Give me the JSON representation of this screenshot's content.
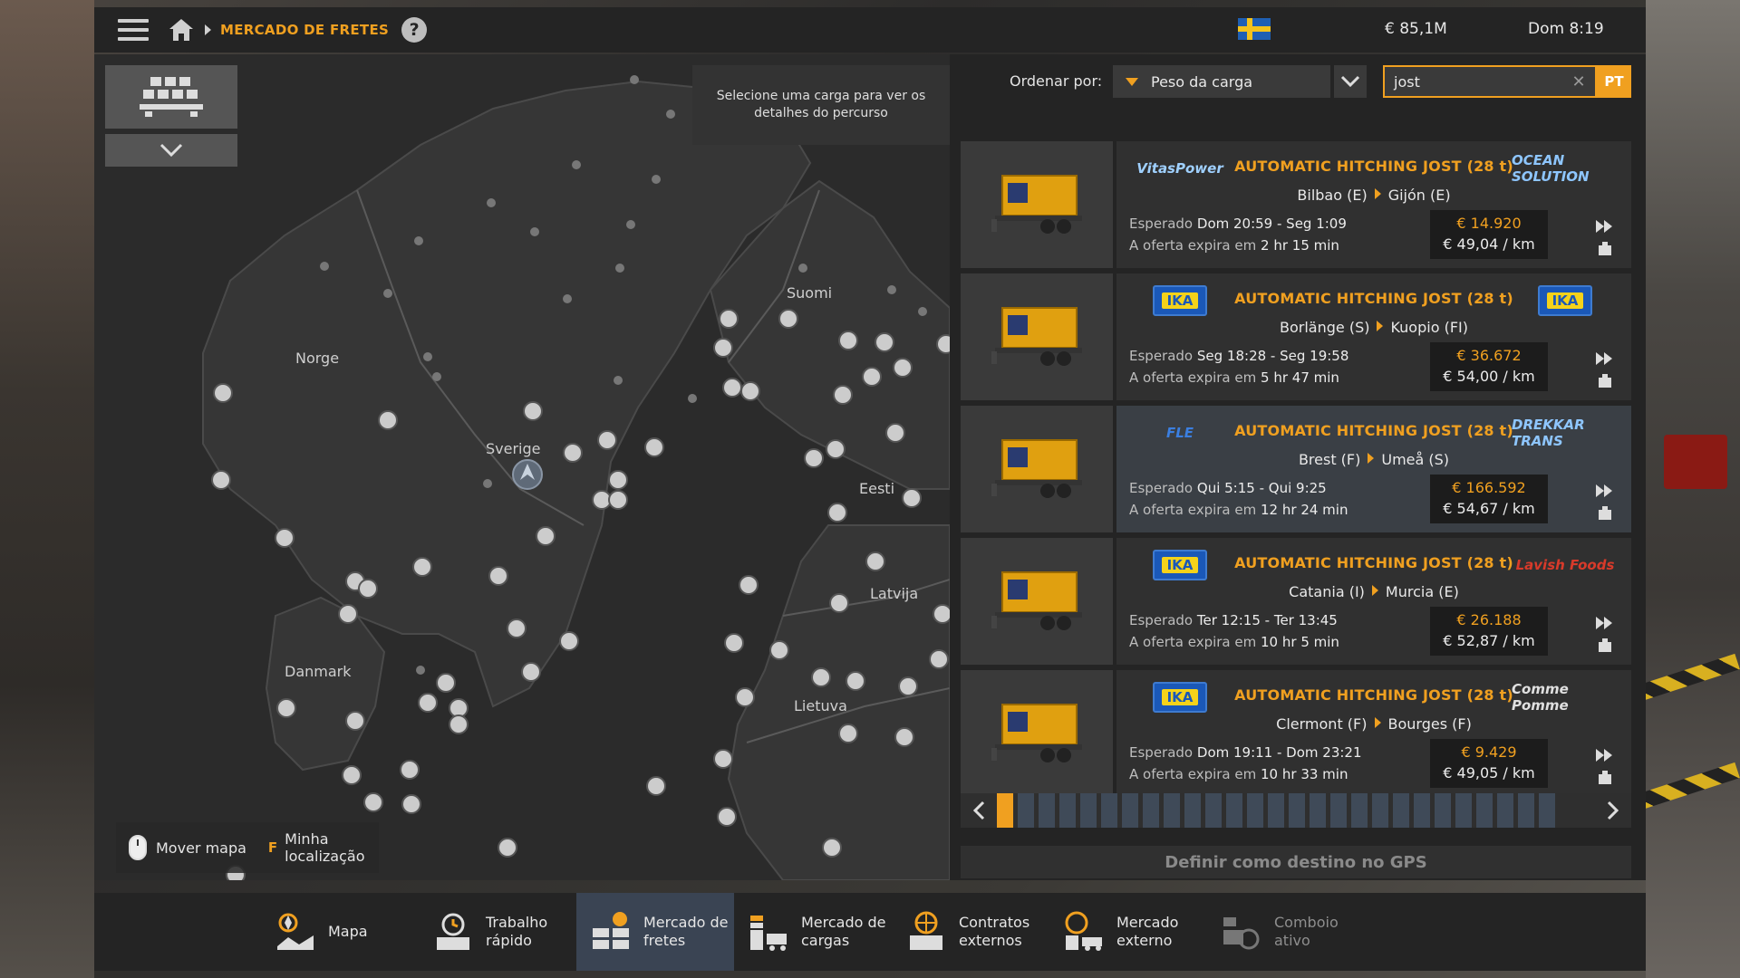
{
  "topbar": {
    "breadcrumb": "MERCADO DE FRETES",
    "money": "€ 85,1M",
    "time": "Dom 8:19"
  },
  "map": {
    "route_hint": "Selecione uma carga para ver os detalhes do percurso",
    "labels": {
      "norge": "Norge",
      "sverige": "Sverige",
      "suomi": "Suomi",
      "eesti": "Eesti",
      "latvija": "Latvija",
      "lietuva": "Lietuva",
      "danmark": "Danmark"
    },
    "controls": {
      "move": "Mover mapa",
      "key": "F",
      "my_location": "Minha localização"
    }
  },
  "sort": {
    "label": "Ordenar por:",
    "selected": "Peso da carga"
  },
  "search": {
    "value": "jost",
    "lang": "PT"
  },
  "jobs": [
    {
      "company_left": "VitasPower",
      "company_right": "OCEAN SOLUTION",
      "cargo": "AUTOMATIC HITCHING JOST (28 t)",
      "from": "Bilbao (E)",
      "to": "Gijón (E)",
      "expected_label": "Esperado",
      "expected": "Dom 20:59 - Seg 1:09",
      "expire_label": "A oferta expira em",
      "expire": "2 hr 15 min",
      "payment": "€ 14.920",
      "per_km": "€ 49,04 / km"
    },
    {
      "company_left": "IKA",
      "company_right": "IKA",
      "cargo": "AUTOMATIC HITCHING JOST (28 t)",
      "from": "Borlänge (S)",
      "to": "Kuopio (FI)",
      "expected_label": "Esperado",
      "expected": "Seg 18:28 - Seg 19:58",
      "expire_label": "A oferta expira em",
      "expire": "5 hr 47 min",
      "payment": "€ 36.672",
      "per_km": "€ 54,00 / km"
    },
    {
      "company_left": "FLE",
      "company_right": "DREKKAR TRANS",
      "cargo": "AUTOMATIC HITCHING JOST (28 t)",
      "from": "Brest (F)",
      "to": "Umeå (S)",
      "expected_label": "Esperado",
      "expected": "Qui 5:15 - Qui 9:25",
      "expire_label": "A oferta expira em",
      "expire": "12 hr 24 min",
      "payment": "€ 166.592",
      "per_km": "€ 54,67 / km"
    },
    {
      "company_left": "IKA",
      "company_right": "Lavish Foods",
      "cargo": "AUTOMATIC HITCHING JOST (28 t)",
      "from": "Catania (I)",
      "to": "Murcia (E)",
      "expected_label": "Esperado",
      "expected": "Ter 12:15 - Ter 13:45",
      "expire_label": "A oferta expira em",
      "expire": "10 hr 5 min",
      "payment": "€ 26.188",
      "per_km": "€ 52,87 / km"
    },
    {
      "company_left": "IKA",
      "company_right": "Comme Pomme",
      "cargo": "AUTOMATIC HITCHING JOST (28 t)",
      "from": "Clermont (F)",
      "to": "Bourges (F)",
      "expected_label": "Esperado",
      "expected": "Dom 19:11 - Dom 23:21",
      "expire_label": "A oferta expira em",
      "expire": "10 hr 33 min",
      "payment": "€ 9.429",
      "per_km": "€ 49,05 / km"
    }
  ],
  "pager": {
    "current_page": 1
  },
  "gps_button": "Definir como destino no GPS",
  "bottom_nav": [
    {
      "line1": "Mapa",
      "line2": "",
      "icon": "map-icon"
    },
    {
      "line1": "Trabalho",
      "line2": "rápido",
      "icon": "quick-job-icon"
    },
    {
      "line1": "Mercado de",
      "line2": "fretes",
      "icon": "freight-market-icon"
    },
    {
      "line1": "Mercado de",
      "line2": "cargas",
      "icon": "cargo-market-icon"
    },
    {
      "line1": "Contratos",
      "line2": "externos",
      "icon": "external-contracts-icon"
    },
    {
      "line1": "Mercado",
      "line2": "externo",
      "icon": "external-market-icon"
    },
    {
      "line1": "Comboio",
      "line2": "ativo",
      "icon": "convoy-icon"
    }
  ],
  "colors": {
    "accent": "#f0a020",
    "panel": "#242424",
    "active_tab": "#3a4453"
  }
}
